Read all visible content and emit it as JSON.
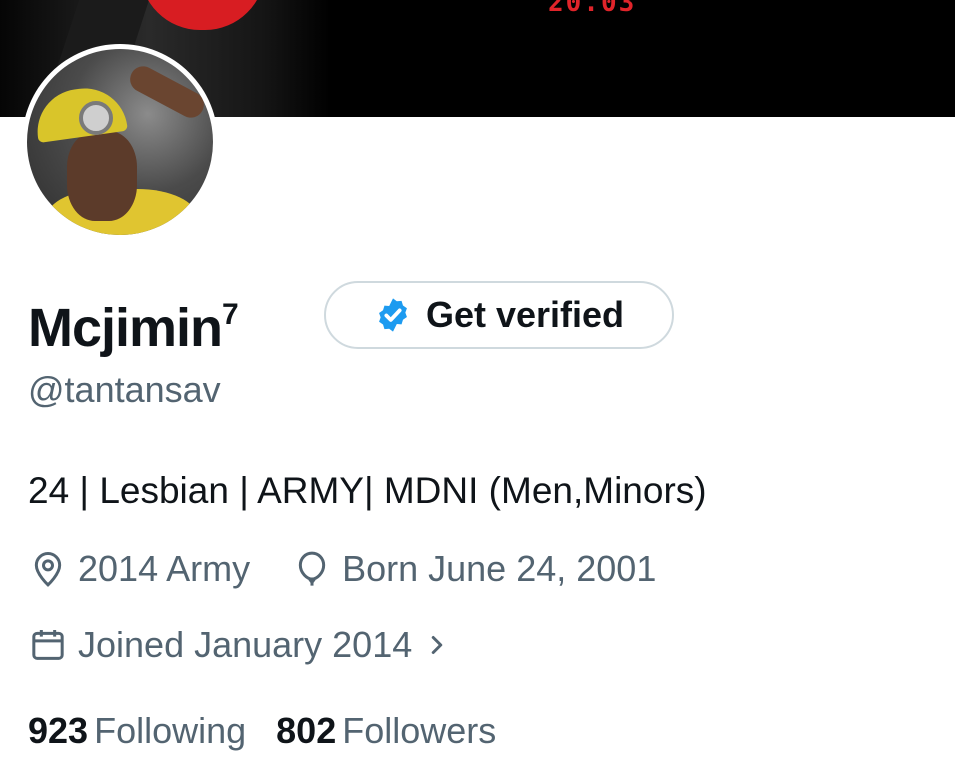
{
  "banner": {
    "date_text": "20.03"
  },
  "profile": {
    "display_name": "Mcjimin",
    "name_superscript": "7",
    "handle": "@tantansav",
    "bio": "24 | Lesbian | ARMY| MDNI (Men,Minors)",
    "verify_button_label": "Get verified",
    "location": "2014 Army",
    "birthday": "Born June 24, 2001",
    "joined": "Joined January 2014"
  },
  "stats": {
    "following_count": "923",
    "following_label": "Following",
    "followers_count": "802",
    "followers_label": "Followers"
  },
  "icons": {
    "location": "location-pin-icon",
    "birthday": "balloon-icon",
    "joined": "calendar-icon",
    "verified": "verified-badge-icon",
    "joined_chevron": "chevron-right-icon"
  },
  "colors": {
    "verified_blue": "#1d9bf0",
    "muted_text": "#536471",
    "primary_text": "#0f1419",
    "border": "#cfd9de"
  }
}
